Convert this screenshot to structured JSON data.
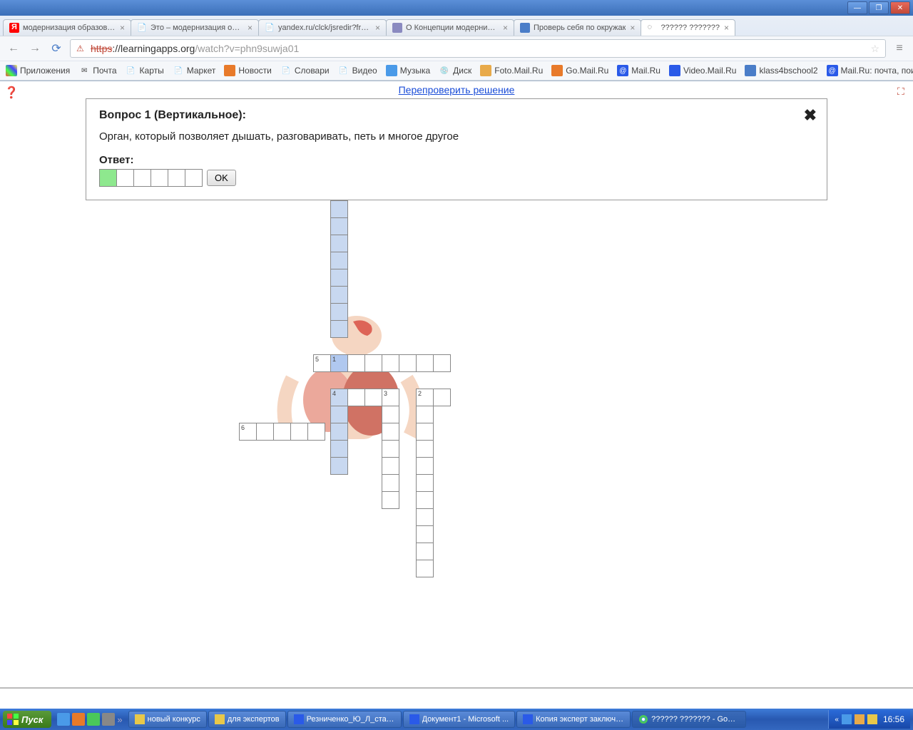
{
  "window": {
    "minimize": "—",
    "maximize": "❐",
    "close": "✕"
  },
  "tabs": [
    {
      "title": "модернизация образован",
      "favicon_color": "#ff0000",
      "favicon_text": "Я"
    },
    {
      "title": "Это – модернизация обра",
      "favicon_color": "#888",
      "favicon_text": "📄"
    },
    {
      "title": "yandex.ru/clck/jsredir?from",
      "favicon_color": "#888",
      "favicon_text": "📄"
    },
    {
      "title": "О Концепции модернизац",
      "favicon_color": "#6a6a9a",
      "favicon_text": "◆"
    },
    {
      "title": "Проверь себя по окружак",
      "favicon_color": "#4a7dc8",
      "favicon_text": "▦"
    },
    {
      "title": "?????? ???????",
      "favicon_color": "#fff",
      "favicon_text": "",
      "active": true
    }
  ],
  "url": {
    "protocol": "https",
    "domain": "://learningapps.org",
    "path": "/watch?v=phn9suwja01"
  },
  "bookmarks": [
    {
      "label": "Приложения",
      "icon": "apps"
    },
    {
      "label": "Почта",
      "icon": "mail"
    },
    {
      "label": "Карты",
      "icon": "page"
    },
    {
      "label": "Маркет",
      "icon": "page"
    },
    {
      "label": "Новости",
      "icon": "news"
    },
    {
      "label": "Словари",
      "icon": "page"
    },
    {
      "label": "Видео",
      "icon": "page"
    },
    {
      "label": "Музыка",
      "icon": "music"
    },
    {
      "label": "Диск",
      "icon": "disk"
    },
    {
      "label": "Foto.Mail.Ru",
      "icon": "foto"
    },
    {
      "label": "Go.Mail.Ru",
      "icon": "go"
    },
    {
      "label": "Mail.Ru",
      "icon": "mailru"
    },
    {
      "label": "Video.Mail.Ru",
      "icon": "video"
    },
    {
      "label": "klass4bschool2",
      "icon": "klass"
    },
    {
      "label": "Mail.Ru: почта, поиск...",
      "icon": "mailru"
    }
  ],
  "recheck": "Перепроверить решение",
  "question": {
    "title": "Вопрос 1 (Вертикальное):",
    "text": "Орган, который позволяет дышать, разговаривать, петь и многое другое",
    "answer_label": "Ответ:",
    "ok": "OK",
    "cell_count": 6
  },
  "crossword_numbers": {
    "n1": "1",
    "n2": "2",
    "n3": "3",
    "n4": "4",
    "n5": "5",
    "n6": "6"
  },
  "taskbar": {
    "start": "Пуск",
    "items": [
      {
        "title": "новый конкурс",
        "icon": "folder"
      },
      {
        "title": "для экспертов",
        "icon": "folder"
      },
      {
        "title": "Резниченко_Ю_Л_стат...",
        "icon": "word"
      },
      {
        "title": "Документ1 - Microsoft ...",
        "icon": "word"
      },
      {
        "title": "Копия эксперт заключ....",
        "icon": "word"
      },
      {
        "title": "?????? ??????? - Goog...",
        "icon": "chrome",
        "active": true
      }
    ],
    "time": "16:56"
  }
}
